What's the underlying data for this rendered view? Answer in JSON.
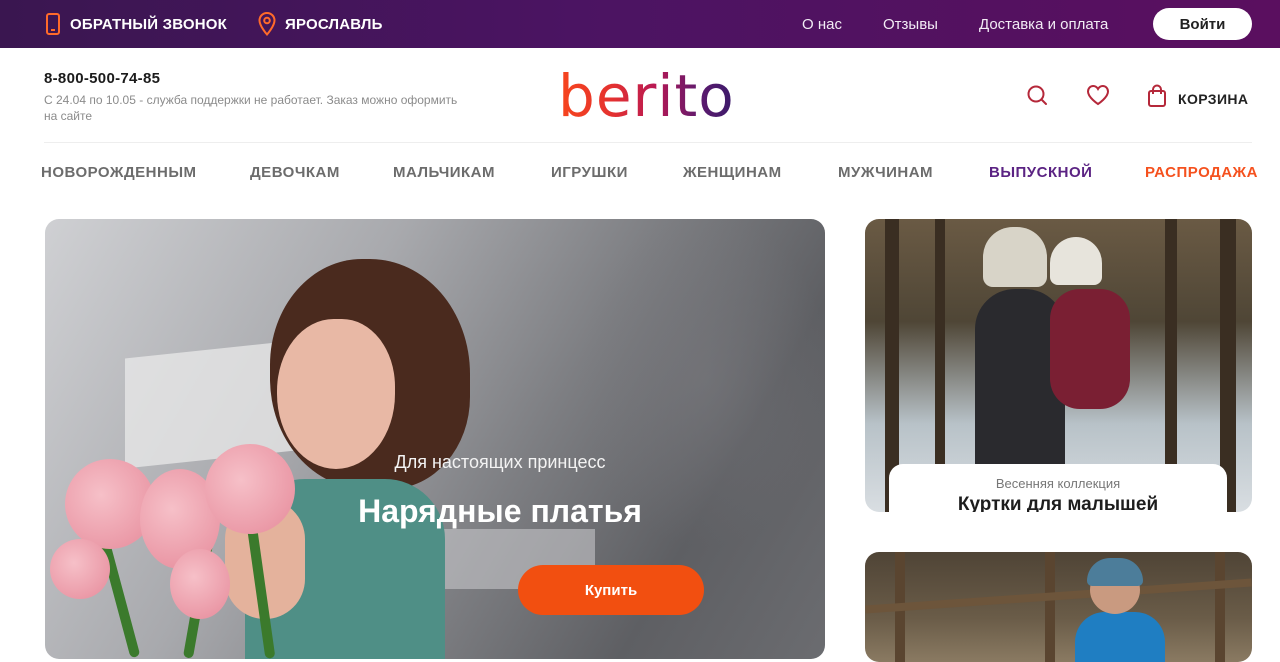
{
  "topbar": {
    "callback_label": "ОБРАТНЫЙ ЗВОНОК",
    "city_label": "ЯРОСЛАВЛЬ",
    "links": [
      "О нас",
      "Отзывы",
      "Доставка и оплата"
    ],
    "login_label": "Войти"
  },
  "header": {
    "phone": "8-800-500-74-85",
    "support_note": "С 24.04 по 10.05 - служба поддержки не работает. Заказ можно оформить на сайте",
    "logo": "berito",
    "cart_label": "КОРЗИНА"
  },
  "nav": [
    "НОВОРОЖДЕННЫМ",
    "ДЕВОЧКАМ",
    "МАЛЬЧИКАМ",
    "ИГРУШКИ",
    "ЖЕНЩИНАМ",
    "МУЖЧИНАМ",
    "ВЫПУСКНОЙ",
    "РАСПРОДАЖА"
  ],
  "hero": {
    "subtitle": "Для настоящих принцесс",
    "title": "Нарядные платья",
    "button": "Купить"
  },
  "cards": [
    {
      "subtitle": "Весенняя коллекция",
      "title": "Куртки для малышей"
    }
  ],
  "colors": {
    "topbar_start": "#3a1650",
    "topbar_end": "#5a0f5f",
    "accent_orange": "#f24f10",
    "accent_purple": "#5b2383",
    "icon_red": "#c0392b"
  },
  "icons": [
    "phone-icon",
    "location-pin-icon",
    "search-icon",
    "heart-icon",
    "bag-icon"
  ]
}
